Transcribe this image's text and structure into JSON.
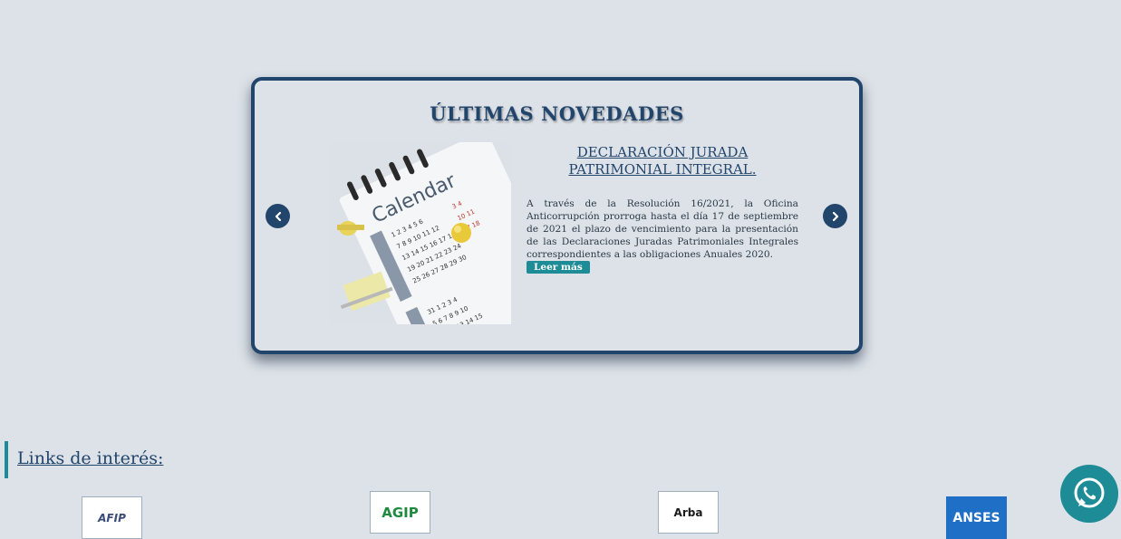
{
  "news": {
    "heading": "ÚLTIMAS NOVEDADES",
    "item_title": "DECLARACIÓN JURADA PATRIMONIAL INTEGRAL.",
    "item_body": "A través de la Resolución 16/2021, la Oficina Anticorrupción prorroga hasta el día 17 de septiembre de 2021 el plazo de vencimiento para la presentación de las Declaraciones Juradas Patrimoniales Integrales correspondientes a las obligaciones Anuales 2020.",
    "read_more": "Leer más",
    "image_calendar_word": "Calendar"
  },
  "links": {
    "heading": "Links de interés:",
    "logos": [
      "AFIP",
      "AGIP",
      "Arba",
      "ANSES"
    ]
  },
  "icons": {
    "prev": "chevron-left-icon",
    "next": "chevron-right-icon",
    "chat": "whatsapp-icon"
  },
  "colors": {
    "background": "#dde2e8",
    "primary": "#22456b",
    "accent": "#1d8c96"
  }
}
